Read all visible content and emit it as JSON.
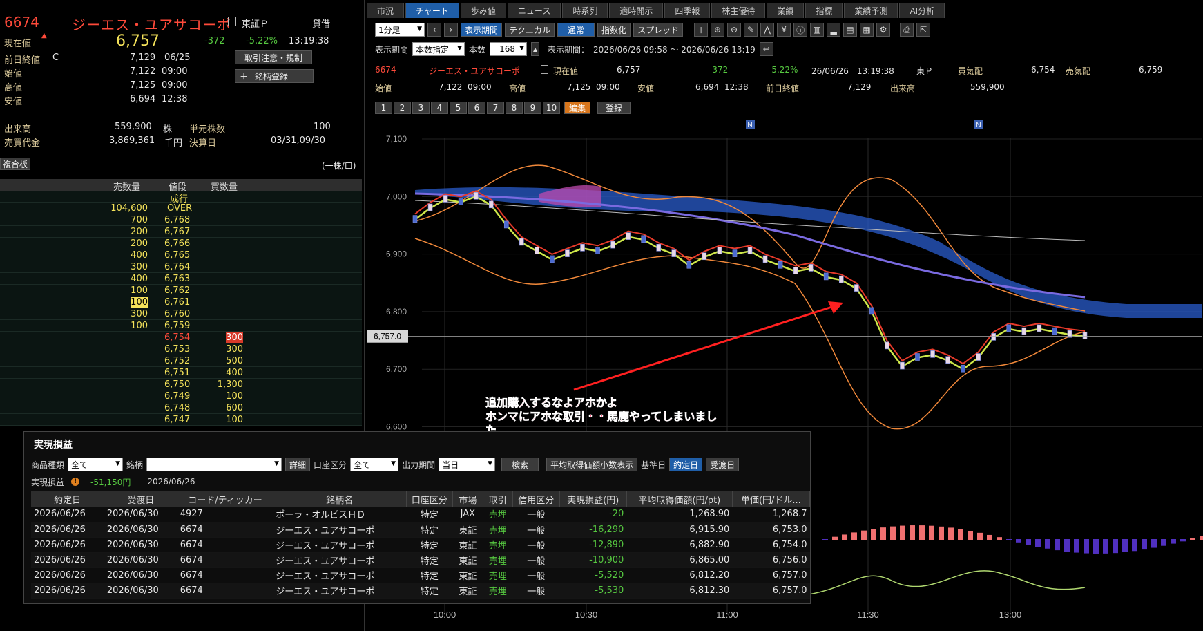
{
  "quote": {
    "code": "6674",
    "name": "ジーエス・ユアサコーポ",
    "market": "東証Ｐ",
    "margin": "貸借",
    "current_label": "現在値",
    "current_price": "6,757",
    "change": "-372",
    "change_pct": "-5.22%",
    "time": "13:19:38",
    "prev_close_label": "前日終値",
    "prev_close_flag": "C",
    "prev_close": "7,129",
    "prev_close_date": "06/25",
    "open_label": "始値",
    "open": "7,122",
    "open_time": "09:00",
    "high_label": "高値",
    "high": "7,125",
    "high_time": "09:00",
    "low_label": "安値",
    "low": "6,694",
    "low_time": "12:38",
    "volume_label": "出来高",
    "volume": "559,900",
    "volume_unit": "株",
    "unit_label": "単元株数",
    "unit_value": "100",
    "turnover_label": "売買代金",
    "turnover": "3,869,361",
    "turnover_unit": "千円",
    "settle_label": "決算日",
    "settle_value": "03/31,09/30",
    "btn_notice": "取引注意・規制",
    "btn_register": "銘柄登録"
  },
  "orderbook": {
    "tab": "複合板",
    "unit": "(一株/口)",
    "col_sell": "売数量",
    "col_price": "値段",
    "col_buy": "買数量",
    "rows": [
      {
        "sell": "",
        "price": "成行",
        "buy": ""
      },
      {
        "sell": "104,600",
        "price": "OVER",
        "buy": ""
      },
      {
        "sell": "700",
        "price": "6,768",
        "buy": ""
      },
      {
        "sell": "200",
        "price": "6,767",
        "buy": ""
      },
      {
        "sell": "200",
        "price": "6,766",
        "buy": ""
      },
      {
        "sell": "400",
        "price": "6,765",
        "buy": ""
      },
      {
        "sell": "300",
        "price": "6,764",
        "buy": ""
      },
      {
        "sell": "400",
        "price": "6,763",
        "buy": ""
      },
      {
        "sell": "100",
        "price": "6,762",
        "buy": ""
      },
      {
        "sell": "100",
        "price": "6,761",
        "buy": ""
      },
      {
        "sell": "300",
        "price": "6,760",
        "buy": ""
      },
      {
        "sell": "100",
        "price": "6,759",
        "buy": ""
      },
      {
        "sell": "",
        "price": "6,754",
        "buy": "300"
      },
      {
        "sell": "",
        "price": "6,753",
        "buy": "300"
      },
      {
        "sell": "",
        "price": "6,752",
        "buy": "500"
      },
      {
        "sell": "",
        "price": "6,751",
        "buy": "400"
      },
      {
        "sell": "",
        "price": "6,750",
        "buy": "1,300"
      },
      {
        "sell": "",
        "price": "6,749",
        "buy": "100"
      },
      {
        "sell": "",
        "price": "6,748",
        "buy": "600"
      },
      {
        "sell": "",
        "price": "6,747",
        "buy": "100"
      }
    ]
  },
  "tabs": [
    "市況",
    "チャート",
    "歩み値",
    "ニュース",
    "時系列",
    "適時開示",
    "四季報",
    "株主優待",
    "業績",
    "指標",
    "業績予測",
    "AI分析"
  ],
  "toolbar": {
    "interval": "1分足",
    "btn_period": "表示期間",
    "btn_technical": "テクニカル",
    "btn_normal": "通常",
    "btn_index": "指数化",
    "btn_spread": "スプレッド",
    "period_label": "表示期間",
    "period_mode": "本数指定",
    "count_label": "本数",
    "count": "168",
    "range_label": "表示期間：",
    "range": "2026/06/26 09:58 ～ 2026/06/26 13:19"
  },
  "chart_header": {
    "code": "6674",
    "name": "ジーエス・ユアサコーポ",
    "current_label": "現在値",
    "current": "6,757",
    "change": "-372",
    "change_pct": "-5.22%",
    "datetime": "26/06/26　13:19:38",
    "market": "東Ｐ",
    "bid_label": "買気配",
    "bid": "6,754",
    "ask_label": "売気配",
    "ask": "6,759",
    "open_label": "始値",
    "open": "7,122",
    "open_time": "09:00",
    "high_label": "高値",
    "high": "7,125",
    "high_time": "09:00",
    "low_label": "安値",
    "low": "6,694",
    "low_time": "12:38",
    "prev_label": "前日終値",
    "prev": "7,129",
    "vol_label": "出来高",
    "vol": "559,900",
    "pages": [
      "1",
      "2",
      "3",
      "4",
      "5",
      "6",
      "7",
      "8",
      "9",
      "10"
    ],
    "edit": "編集",
    "save": "登録"
  },
  "chart_data": {
    "type": "line",
    "y_ticks": [
      "7,100",
      "7,000",
      "6,900",
      "6,800",
      "6,700",
      "6,600"
    ],
    "x_ticks": [
      "10:00",
      "10:30",
      "11:00",
      "11:30",
      "13:00"
    ],
    "current_label": "6,757.0",
    "news_markers": [
      "N",
      "N"
    ],
    "ylim": [
      6600,
      7100
    ],
    "price": [
      6960,
      6980,
      6995,
      6990,
      7000,
      6985,
      6950,
      6920,
      6905,
      6890,
      6900,
      6910,
      6905,
      6915,
      6930,
      6925,
      6910,
      6900,
      6880,
      6895,
      6905,
      6900,
      6905,
      6890,
      6880,
      6870,
      6875,
      6860,
      6855,
      6840,
      6800,
      6740,
      6705,
      6720,
      6725,
      6715,
      6700,
      6720,
      6755,
      6770,
      6765,
      6770,
      6765,
      6760,
      6757
    ],
    "annotation": [
      "追加購入するなよアホかよ",
      "ホンマにアホな取引・・馬鹿やってしまいまし",
      "た。"
    ]
  },
  "pnl": {
    "title": "実現損益",
    "f_type": "商品種類",
    "f_type_val": "全て",
    "f_brand": "銘柄",
    "f_brand_val": "",
    "btn_detail": "詳細",
    "f_account": "口座区分",
    "f_account_val": "全て",
    "f_period": "出力期間",
    "f_period_val": "当日",
    "btn_search": "検索",
    "btn_avg": "平均取得価額小数表示",
    "basis_label": "基準日",
    "btn_trade": "約定日",
    "btn_settle": "受渡日",
    "sum_label": "実現損益",
    "sum_value": "-51,150円",
    "sum_date": "2026/06/26",
    "columns": [
      "約定日",
      "受渡日",
      "コード/ティッカー",
      "銘柄名",
      "口座区分",
      "市場",
      "取引",
      "信用区分",
      "実現損益(円)",
      "平均取得価額(円/pt)",
      "単価(円/ドル..."
    ],
    "rows": [
      [
        "2026/06/26",
        "2026/06/30",
        "4927",
        "ポーラ・オルビスＨＤ",
        "特定",
        "JAX",
        "売埋",
        "一般",
        "-20",
        "1,268.90",
        "1,268.7"
      ],
      [
        "2026/06/26",
        "2026/06/30",
        "6674",
        "ジーエス・ユアサコーポ",
        "特定",
        "東証",
        "売埋",
        "一般",
        "-16,290",
        "6,915.90",
        "6,753.0"
      ],
      [
        "2026/06/26",
        "2026/06/30",
        "6674",
        "ジーエス・ユアサコーポ",
        "特定",
        "東証",
        "売埋",
        "一般",
        "-12,890",
        "6,882.90",
        "6,754.0"
      ],
      [
        "2026/06/26",
        "2026/06/30",
        "6674",
        "ジーエス・ユアサコーポ",
        "特定",
        "東証",
        "売埋",
        "一般",
        "-10,900",
        "6,865.00",
        "6,756.0"
      ],
      [
        "2026/06/26",
        "2026/06/30",
        "6674",
        "ジーエス・ユアサコーポ",
        "特定",
        "東証",
        "売埋",
        "一般",
        "-5,520",
        "6,812.20",
        "6,757.0"
      ],
      [
        "2026/06/26",
        "2026/06/30",
        "6674",
        "ジーエス・ユアサコーポ",
        "特定",
        "東証",
        "売埋",
        "一般",
        "-5,530",
        "6,812.30",
        "6,757.0"
      ]
    ]
  }
}
